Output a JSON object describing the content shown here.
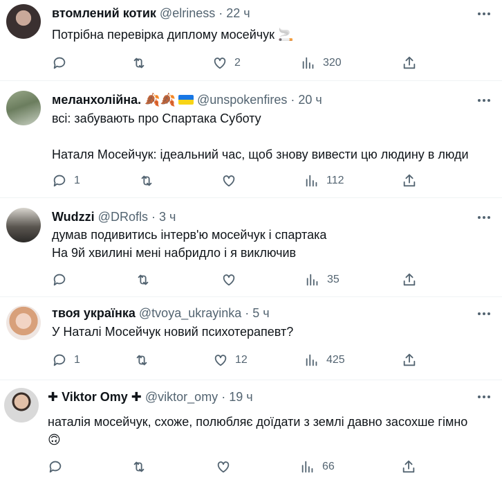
{
  "tweets": [
    {
      "name": "втомлений котик",
      "handle": "@elriness",
      "time": "22 ч",
      "lines": [
        "Потрібна перевірка диплому мосейчук 🚬"
      ],
      "counts": {
        "reply": "",
        "retweet": "",
        "like": "2",
        "views": "320"
      }
    },
    {
      "name": "меланхолійна. 🍂🍂",
      "handle": "@unspokenfires",
      "time": "20 ч",
      "lines": [
        "всі: забувають про Спартака Суботу",
        "",
        "Наталя Мосейчук: ідеальний час, щоб знову вивести цю людину в люди"
      ],
      "counts": {
        "reply": "1",
        "retweet": "",
        "like": "",
        "views": "112"
      }
    },
    {
      "name": "Wudzzi",
      "handle": "@DRofls",
      "time": "3 ч",
      "lines": [
        "думав подивитись інтерв'ю мосейчук і спартака",
        "На 9й хвилині мені набридло і я виключив"
      ],
      "counts": {
        "reply": "",
        "retweet": "",
        "like": "",
        "views": "35"
      }
    },
    {
      "name": "твоя українка",
      "handle": "@tvoya_ukrayinka",
      "time": "5 ч",
      "lines": [
        "У Наталі Мосейчук новий психотерапевт?"
      ],
      "counts": {
        "reply": "1",
        "retweet": "",
        "like": "12",
        "views": "425"
      }
    },
    {
      "name": "✚ Viktor Omy ✚",
      "handle": "@viktor_omy",
      "time": "19 ч",
      "lines": [
        "наталія мосейчук, схоже, полюбляє доїдати з землі давно засохше гімно",
        "🙃"
      ],
      "counts": {
        "reply": "",
        "retweet": "",
        "like": "",
        "views": "66"
      }
    }
  ],
  "separator": "·",
  "icons": [
    "reply-icon",
    "retweet-icon",
    "like-icon",
    "views-icon",
    "share-icon",
    "more-icon"
  ],
  "colors": {
    "text": "#0f1419",
    "secondary": "#536471",
    "divider": "#eff3f4"
  }
}
